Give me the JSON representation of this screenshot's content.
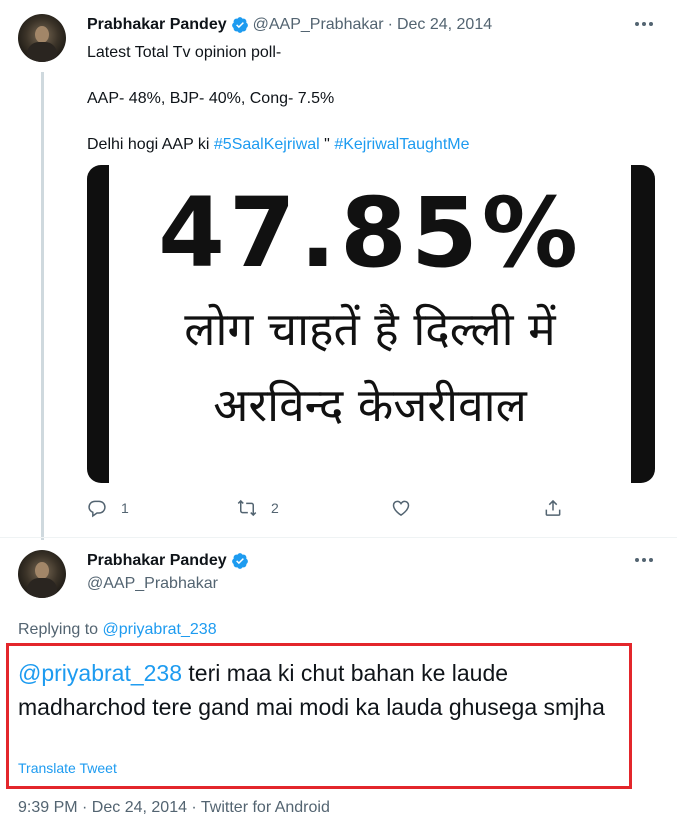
{
  "tweet1": {
    "display_name": "Prabhakar Pandey",
    "handle": "@AAP_Prabhakar",
    "separator": "·",
    "date": "Dec 24, 2014",
    "text_line1": "Latest Total Tv opinion poll-",
    "text_line2": "AAP- 48%, BJP- 40%, Cong- 7.5%",
    "text_line3_prefix": "Delhi hogi AAP ki ",
    "hashtag1": "#5SaalKejriwal",
    "text_line3_mid": " \" ",
    "hashtag2": "#KejriwalTaughtMe",
    "image": {
      "big_text": "47.85%",
      "line2": "लोग चाहतें है दिल्ली में",
      "line3": "अरविन्द केजरीवाल"
    },
    "actions": {
      "reply_count": "1",
      "retweet_count": "2"
    }
  },
  "tweet2": {
    "display_name": "Prabhakar Pandey",
    "handle": "@AAP_Prabhakar",
    "replying_prefix": "Replying to ",
    "replying_to": "@priyabrat_238",
    "mention": "@priyabrat_238",
    "text": " teri maa  ki chut bahan ke laude madharchod tere gand mai modi ka lauda ghusega smjha",
    "translate_label": "Translate Tweet",
    "meta": "9:39 PM · Dec 24, 2014 · Twitter for Android"
  },
  "colors": {
    "accent": "#1d9bf0",
    "highlight": "#e3262b",
    "muted": "#536471"
  }
}
